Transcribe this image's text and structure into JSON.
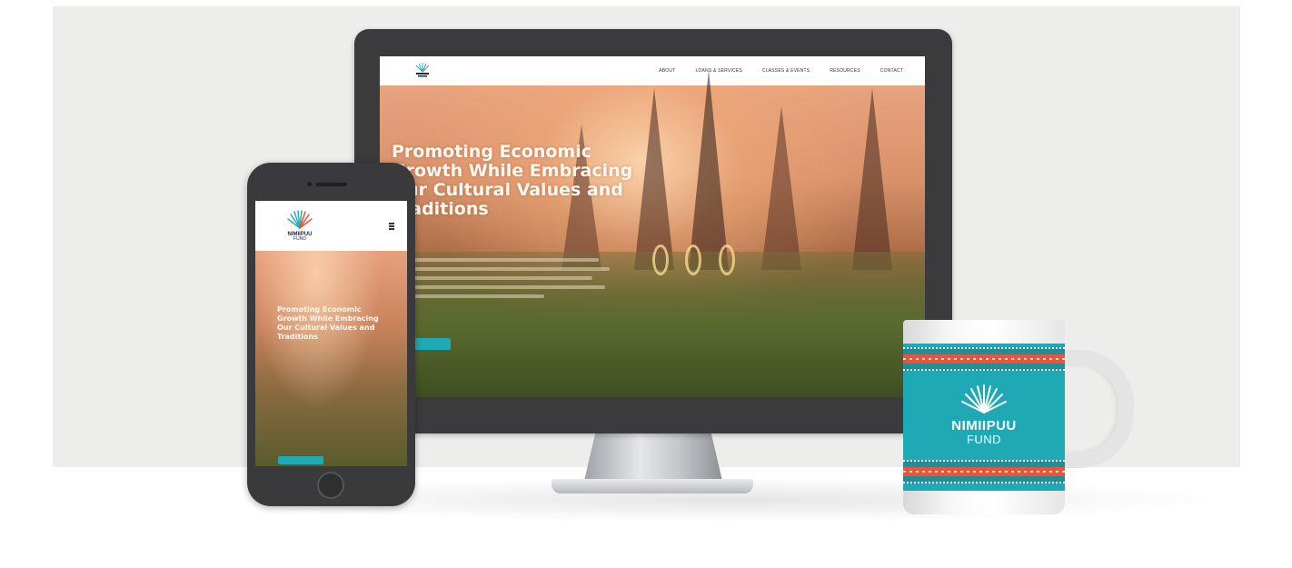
{
  "monitor": {
    "nav": {
      "links": [
        "ABOUT",
        "LOANS & SERVICES",
        "CLASSES & EVENTS",
        "RESOURCES",
        "CONTACT"
      ]
    },
    "hero": {
      "title": "Promoting Economic Growth While Embracing Our Cultural Values and Traditions"
    }
  },
  "phone": {
    "logo": {
      "name": "NIMIIPUU",
      "sub": "FUND"
    },
    "hero": {
      "title": "Promoting Economic Growth While Embracing Our Cultural Values and Traditions"
    }
  },
  "mug": {
    "brand_name": "NIMIIPUU",
    "brand_sub": "FUND"
  },
  "colors": {
    "brand_teal": "#1fa9b4",
    "accent_orange": "#e8553a",
    "device_dark": "#3b3b3d",
    "backdrop": "#ededec"
  }
}
